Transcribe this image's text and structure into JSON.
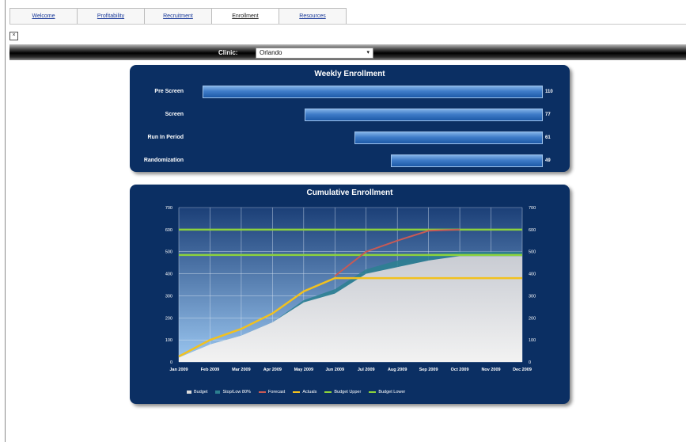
{
  "tabs": [
    {
      "label": "Welcome",
      "active": false
    },
    {
      "label": "Profitability",
      "active": false
    },
    {
      "label": "Recruitment",
      "active": false
    },
    {
      "label": "Enrollment",
      "active": true
    },
    {
      "label": "Resources",
      "active": false
    }
  ],
  "close_glyph": "×",
  "filter": {
    "label": "Clinic:",
    "value": "Orlando",
    "arrow": "▾"
  },
  "chart_data": [
    {
      "type": "bar",
      "orientation": "horizontal",
      "title": "Weekly Enrollment",
      "categories": [
        "Pre Screen",
        "Screen",
        "Run In Period",
        "Randomization"
      ],
      "values": [
        110,
        77,
        61,
        49
      ],
      "value_labels": [
        "110",
        "77",
        "61",
        "49"
      ],
      "xlim": [
        0,
        110
      ],
      "bar_color": "#3f7cc8"
    },
    {
      "type": "area",
      "title": "Cumulative Enrollment",
      "categories": [
        "Jan 2009",
        "Feb 2009",
        "Mar 2009",
        "Apr 2009",
        "May 2009",
        "Jun 2009",
        "Jul 2009",
        "Aug 2009",
        "Sep 2009",
        "Oct 2009",
        "Nov 2009",
        "Dec 2009"
      ],
      "ylim": [
        0,
        700
      ],
      "yticks": [
        0,
        100,
        200,
        300,
        400,
        500,
        600,
        700
      ],
      "grid": true,
      "legend_position": "bottom",
      "series": [
        {
          "name": "Budget",
          "kind": "area",
          "color": "#dcdcdc",
          "values": [
            20,
            80,
            120,
            180,
            270,
            310,
            400,
            430,
            460,
            480,
            480,
            480
          ]
        },
        {
          "name": "Stop/Low 80%",
          "kind": "area",
          "color": "#2c8090",
          "values": [
            20,
            80,
            120,
            180,
            280,
            330,
            420,
            460,
            490,
            500,
            500,
            500
          ]
        },
        {
          "name": "Forecast",
          "kind": "line",
          "color": "#c85a55",
          "values": [
            null,
            null,
            null,
            null,
            null,
            390,
            500,
            550,
            595,
            600,
            null,
            null
          ]
        },
        {
          "name": "Actuals",
          "kind": "line",
          "color": "#f2c11e",
          "values": [
            25,
            100,
            150,
            220,
            320,
            380,
            380,
            380,
            380,
            380,
            380,
            380
          ]
        },
        {
          "name": "Budget Upper",
          "kind": "line",
          "color": "#8cd23c",
          "values": [
            600,
            600,
            600,
            600,
            600,
            600,
            600,
            600,
            600,
            600,
            600,
            600
          ]
        },
        {
          "name": "Budget Lower",
          "kind": "line",
          "color": "#8cd23c",
          "values": [
            485,
            485,
            485,
            485,
            485,
            485,
            485,
            485,
            485,
            485,
            485,
            485
          ]
        }
      ]
    }
  ]
}
